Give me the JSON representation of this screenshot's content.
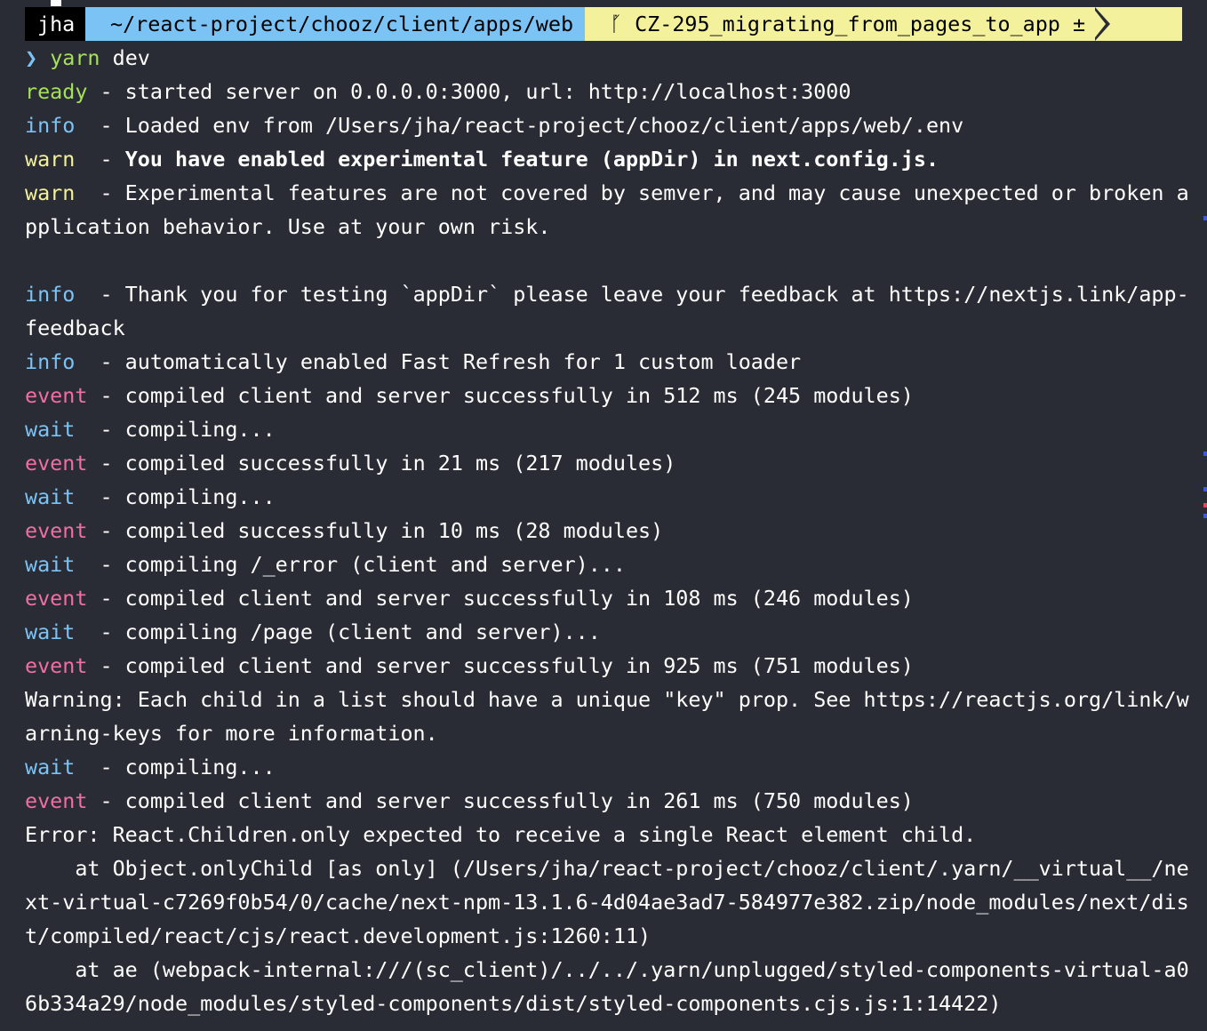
{
  "prompt": {
    "user": "jha",
    "path": "~/react-project/chooz/client/apps/web",
    "branch": "CZ-295_migrating_from_pages_to_app",
    "dirty_marker": "±",
    "branch_icon": "git-branch-icon",
    "colors": {
      "user_bg": "#000000",
      "path_bg": "#7cc3f5",
      "git_bg": "#f3f19b"
    }
  },
  "command": {
    "chevron": "❯",
    "program": "yarn",
    "args": "dev"
  },
  "log": [
    {
      "level": "ready",
      "pad": " ",
      "text": "- started server on 0.0.0.0:3000, url: http://localhost:3000"
    },
    {
      "level": "info",
      "pad": "  ",
      "text": "- Loaded env from /Users/jha/react-project/chooz/client/apps/web/.env"
    },
    {
      "level": "warn",
      "pad": "  ",
      "text": "- ",
      "bold": "You have enabled experimental feature (appDir) in next.config.js."
    },
    {
      "level": "warn",
      "pad": "  ",
      "text": "- Experimental features are not covered by semver, and may cause unexpected or broken a",
      "cont": "pplication behavior. Use at your own risk."
    },
    {
      "blank": true
    },
    {
      "level": "info",
      "pad": "  ",
      "text": "- Thank you for testing `appDir` please leave your feedback at https://nextjs.link/app-",
      "cont": "feedback"
    },
    {
      "level": "info",
      "pad": "  ",
      "text": "- automatically enabled Fast Refresh for 1 custom loader"
    },
    {
      "level": "event",
      "pad": " ",
      "text": "- compiled client and server successfully in 512 ms (245 modules)"
    },
    {
      "level": "wait",
      "pad": "  ",
      "text": "- compiling..."
    },
    {
      "level": "event",
      "pad": " ",
      "text": "- compiled successfully in 21 ms (217 modules)"
    },
    {
      "level": "wait",
      "pad": "  ",
      "text": "- compiling..."
    },
    {
      "level": "event",
      "pad": " ",
      "text": "- compiled successfully in 10 ms (28 modules)"
    },
    {
      "level": "wait",
      "pad": "  ",
      "text": "- compiling /_error (client and server)..."
    },
    {
      "level": "event",
      "pad": " ",
      "text": "- compiled client and server successfully in 108 ms (246 modules)"
    },
    {
      "level": "wait",
      "pad": "  ",
      "text": "- compiling /page (client and server)..."
    },
    {
      "level": "event",
      "pad": " ",
      "text": "- compiled client and server successfully in 925 ms (751 modules)"
    },
    {
      "plain": "Warning: Each child in a list should have a unique \"key\" prop. See https://reactjs.org/link/w",
      "cont": "arning-keys for more information."
    },
    {
      "level": "wait",
      "pad": "  ",
      "text": "- compiling..."
    },
    {
      "level": "event",
      "pad": " ",
      "text": "- compiled client and server successfully in 261 ms (750 modules)"
    },
    {
      "plain": "Error: React.Children.only expected to receive a single React element child."
    },
    {
      "plain": "    at Object.onlyChild [as only] (/Users/jha/react-project/chooz/client/.yarn/__virtual__/ne",
      "cont": "xt-virtual-c7269f0b54/0/cache/next-npm-13.1.6-4d04ae3ad7-584977e382.zip/node_modules/next/dis",
      "cont2": "t/compiled/react/cjs/react.development.js:1260:11)"
    },
    {
      "plain": "    at ae (webpack-internal:///(sc_client)/../../.yarn/unplugged/styled-components-virtual-a0",
      "cont": "6b334a29/node_modules/styled-components/dist/styled-components.cjs.js:1:14422)"
    }
  ]
}
